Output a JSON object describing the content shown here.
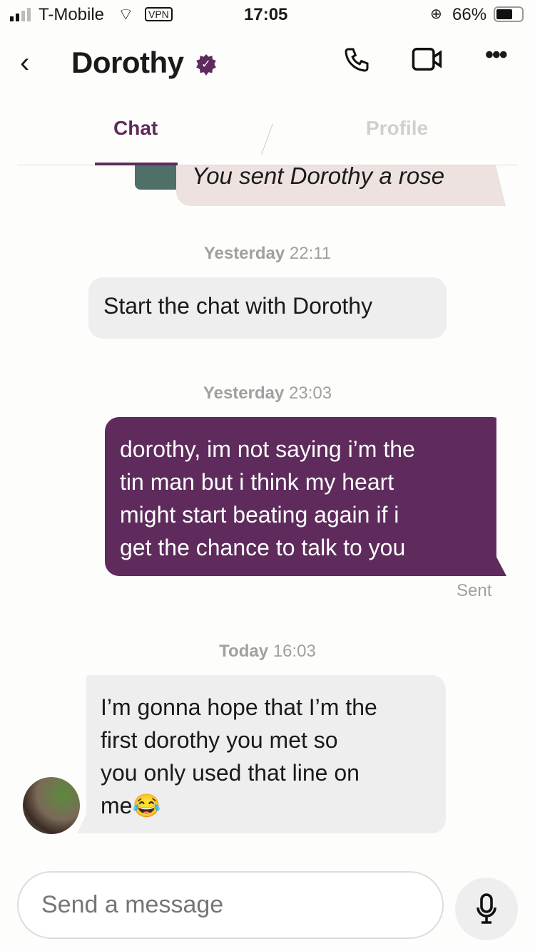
{
  "status_bar": {
    "carrier": "T-Mobile",
    "vpn": "VPN",
    "time": "17:05",
    "battery": "66%"
  },
  "header": {
    "title": "Dorothy",
    "verified": "verified-badge-icon"
  },
  "tabs": [
    {
      "label": "Chat",
      "active": true
    },
    {
      "label": "Profile",
      "active": false
    }
  ],
  "rose_notice": "You sent Dorothy a rose",
  "messages": [
    {
      "timestamp_day": "Yesterday",
      "timestamp_time": "22:11",
      "type": "system",
      "lines": [
        "Start the chat with Dorothy"
      ]
    },
    {
      "timestamp_day": "Yesterday",
      "timestamp_time": "23:03",
      "type": "sent",
      "lines": [
        "dorothy, im not saying i’m the",
        "tin man but i think my heart",
        "might start beating again if i",
        "get the chance to talk to you"
      ],
      "status": "Sent"
    },
    {
      "timestamp_day": "Today",
      "timestamp_time": "16:03",
      "type": "received",
      "lines": [
        "I’m gonna hope that I’m the",
        "first dorothy you met so",
        "you only used that line on",
        "me😂"
      ]
    }
  ],
  "composer": {
    "placeholder": "Send a message"
  },
  "colors": {
    "accent": "#5e2b5c",
    "received_bg": "#eeeeee",
    "rose_bg": "#ede2df"
  }
}
